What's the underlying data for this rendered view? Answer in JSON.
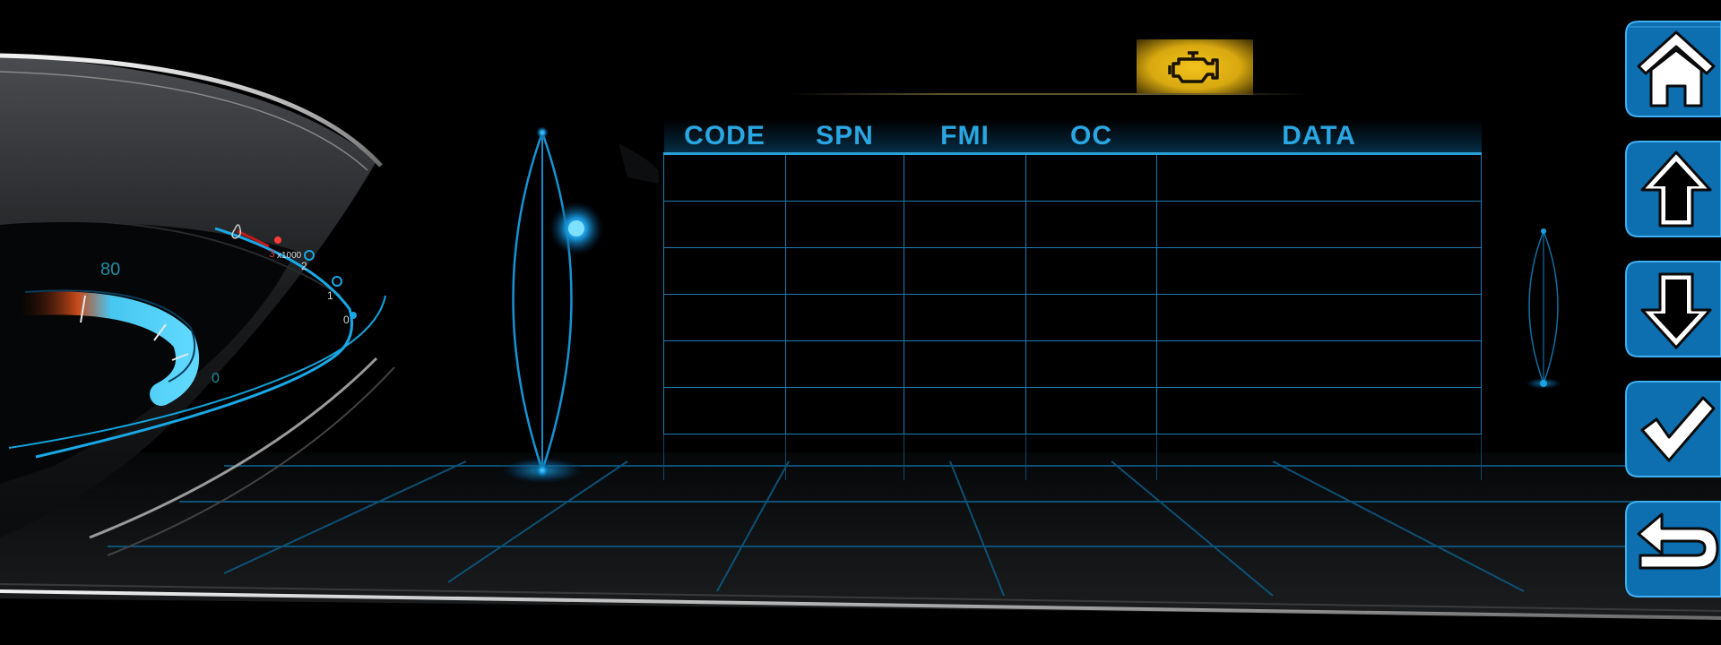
{
  "gauge": {
    "speed_label_80": "80",
    "speed_label_0": "0",
    "tacho_3": "3",
    "tacho_unit": "x1000",
    "tacho_2": "2",
    "tacho_1": "1",
    "tacho_0": "0"
  },
  "warning": {
    "icon": "check-engine-icon",
    "color": "#f2c21b"
  },
  "table": {
    "headers": [
      "CODE",
      "SPN",
      "FMI",
      "OC",
      "DATA"
    ],
    "rows": [
      [
        "",
        "",
        "",
        "",
        ""
      ],
      [
        "",
        "",
        "",
        "",
        ""
      ],
      [
        "",
        "",
        "",
        "",
        ""
      ],
      [
        "",
        "",
        "",
        "",
        ""
      ],
      [
        "",
        "",
        "",
        "",
        ""
      ],
      [
        "",
        "",
        "",
        "",
        ""
      ],
      [
        "",
        "",
        "",
        "",
        ""
      ]
    ],
    "accent": "#2aa6e2"
  },
  "side_buttons": [
    {
      "name": "home-button",
      "icon": "home-icon"
    },
    {
      "name": "scroll-up-button",
      "icon": "arrow-up-icon"
    },
    {
      "name": "scroll-down-button",
      "icon": "arrow-down-icon"
    },
    {
      "name": "confirm-button",
      "icon": "checkmark-icon"
    },
    {
      "name": "back-button",
      "icon": "return-icon"
    }
  ],
  "colors": {
    "background": "#000000",
    "accent_blue": "#2aa6e2",
    "grid_blue": "#1e7bb2",
    "button_blue": "#0d6fb0",
    "warning_yellow": "#f2c21b"
  }
}
